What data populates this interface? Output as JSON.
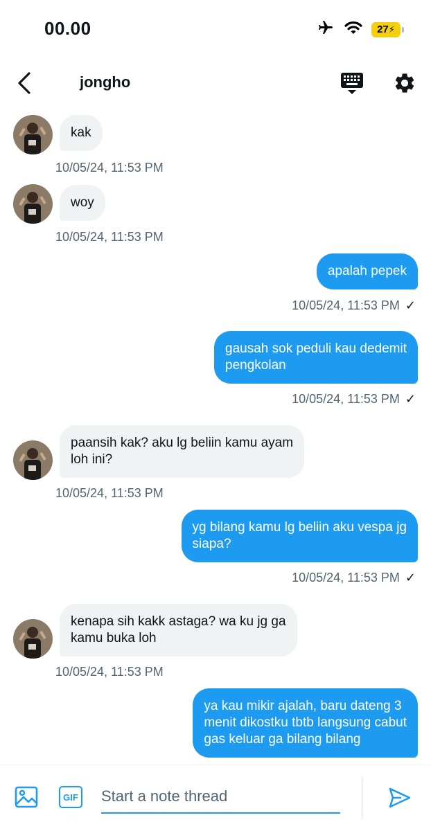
{
  "status_bar": {
    "time": "00.00",
    "battery": "27",
    "icons": [
      "airplane-mode-icon",
      "wifi-icon",
      "battery-charging-icon"
    ]
  },
  "header": {
    "title": "jongho",
    "icons": [
      "back-arrow-icon",
      "keyboard-icon",
      "gear-icon"
    ]
  },
  "messages": [
    {
      "direction": "in",
      "text": "kak",
      "timestamp": "10/05/24, 11:53 PM"
    },
    {
      "direction": "in",
      "text": "woy",
      "timestamp": "10/05/24, 11:53 PM"
    },
    {
      "direction": "out",
      "text": "apalah pepek",
      "timestamp": "10/05/24, 11:53 PM",
      "status": "✓"
    },
    {
      "direction": "out",
      "text": "gausah sok peduli kau dedemit\npengkolan",
      "timestamp": "10/05/24, 11:53 PM",
      "status": "✓"
    },
    {
      "direction": "in",
      "text": "paansih kak? aku lg beliin kamu ayam\nloh ini?",
      "timestamp": "10/05/24, 11:53 PM"
    },
    {
      "direction": "out",
      "text": "yg bilang kamu lg beliin aku vespa jg\nsiapa?",
      "timestamp": "10/05/24, 11:53 PM",
      "status": "✓"
    },
    {
      "direction": "in",
      "text": "kenapa sih kakk astaga? wa ku jg ga\nkamu buka loh",
      "timestamp": "10/05/24, 11:53 PM"
    },
    {
      "direction": "out",
      "text": "ya kau mikir ajalah, baru dateng 3\nmenit dikostku tbtb langsung cabut\ngas keluar ga bilang bilang",
      "timestamp": "",
      "status": ""
    }
  ],
  "composer": {
    "gif_label": "GIF",
    "placeholder": "Start a note thread",
    "value": "",
    "icons": [
      "image-icon",
      "send-icon"
    ]
  },
  "colors": {
    "accent": "#1d9bf0",
    "incoming_bubble": "#eff3f4",
    "timestamp": "#536471",
    "battery": "#f5d10d"
  }
}
